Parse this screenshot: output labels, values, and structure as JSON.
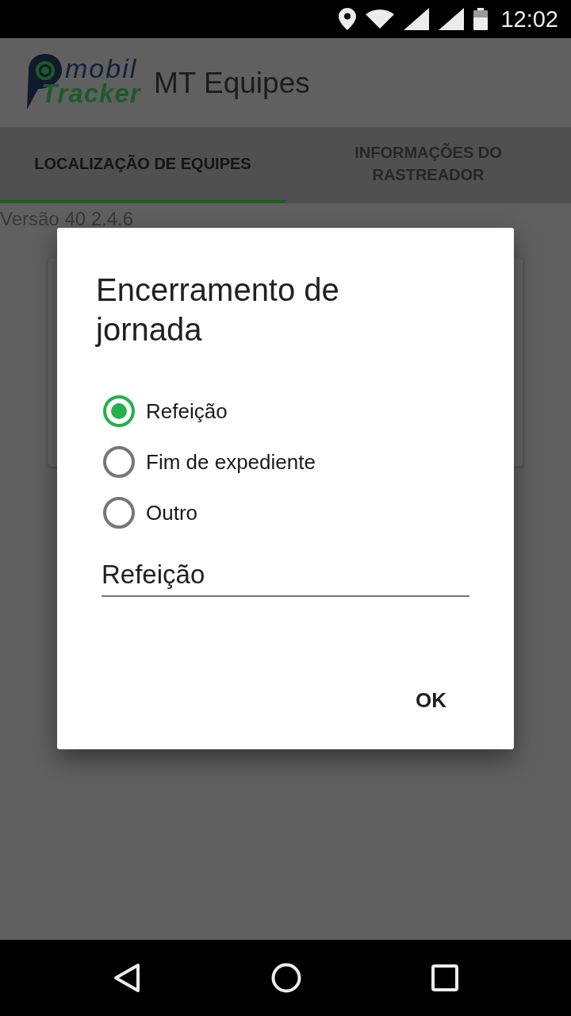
{
  "status_bar": {
    "time": "12:02"
  },
  "app_bar": {
    "logo": {
      "line_1": "mobil",
      "line_2": "Tracker"
    },
    "title": "MT Equipes"
  },
  "tabs": [
    {
      "label": "LOCALIZAÇÃO DE EQUIPES",
      "selected": true
    },
    {
      "label": "INFORMAÇÕES DO RASTREADOR",
      "selected": false
    }
  ],
  "version": "Versão 40 2.4.6",
  "dialog": {
    "title": "Encerramento de jornada",
    "options": [
      {
        "label": "Refeição",
        "selected": true
      },
      {
        "label": "Fim de expediente",
        "selected": false
      },
      {
        "label": "Outro",
        "selected": false
      }
    ],
    "input": {
      "value": "Refeição"
    },
    "buttons": [
      "OK"
    ]
  }
}
